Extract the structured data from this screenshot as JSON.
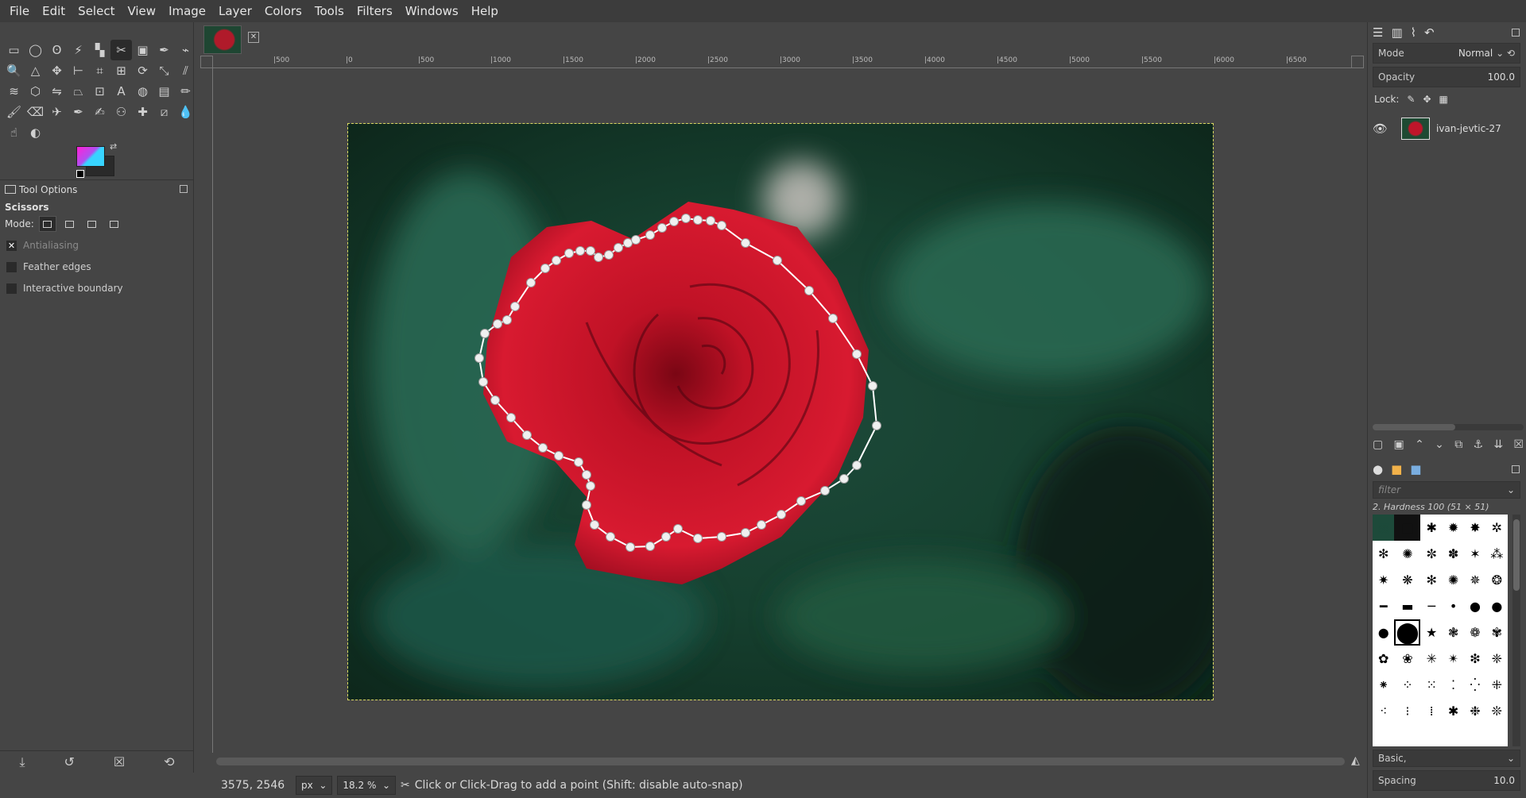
{
  "menubar": {
    "items": [
      "File",
      "Edit",
      "Select",
      "View",
      "Image",
      "Layer",
      "Colors",
      "Tools",
      "Filters",
      "Windows",
      "Help"
    ]
  },
  "toolbox": {
    "tools": [
      "rect-select-tool",
      "ellipse-select-tool",
      "free-select-tool",
      "fuzzy-select-tool",
      "select-by-color-tool",
      "scissors-select-tool",
      "foreground-select-tool",
      "paths-tool",
      "color-picker-tool",
      "zoom-tool",
      "measure-tool",
      "move-tool",
      "align-tool",
      "crop-tool",
      "unified-transform-tool",
      "rotate-tool",
      "scale-tool",
      "shear-tool",
      "warp-transform-tool",
      "cage-transform-tool",
      "flip-tool",
      "perspective-tool",
      "handle-transform-tool",
      "text-tool",
      "bucket-fill-tool",
      "gradient-tool",
      "pencil-tool",
      "paintbrush-tool",
      "eraser-tool",
      "airbrush-tool",
      "ink-tool",
      "mypaint-brush-tool",
      "clone-tool",
      "heal-tool",
      "perspective-clone-tool",
      "blur-sharpen-tool",
      "smudge-tool",
      "dodge-burn-tool"
    ],
    "active_tool": "scissors-select-tool",
    "colors": {
      "foreground": "#3fcfff",
      "background": "#2a2a2a"
    }
  },
  "tool_options": {
    "header": "Tool Options",
    "tool_name": "Scissors",
    "mode_label": "Mode:",
    "options": [
      {
        "label": "Antialiasing",
        "checked": true,
        "dim": true
      },
      {
        "label": "Feather edges",
        "checked": false,
        "dim": false
      },
      {
        "label": "Interactive boundary",
        "checked": false,
        "dim": false
      }
    ]
  },
  "ruler": {
    "top_labels": [
      "|500",
      "|0",
      "|500",
      "|1000",
      "|1500",
      "|2000",
      "|2500",
      "|3000",
      "|3500",
      "|4000",
      "|4500",
      "|5000",
      "|5500",
      "|6000",
      "|6500"
    ]
  },
  "statusbar": {
    "coords": "3575, 2546",
    "unit": "px",
    "zoom": "18.2 %",
    "message": "Click or Click-Drag to add a point (Shift: disable auto-snap)"
  },
  "layers": {
    "mode_label": "Mode",
    "mode_value": "Normal",
    "opacity_label": "Opacity",
    "opacity_value": "100.0",
    "lock_label": "Lock:",
    "layer_name": "ivan-jevtic-27"
  },
  "brushes": {
    "filter_placeholder": "filter",
    "selected_brush": "2. Hardness 100 (51 × 51)",
    "preset": "Basic,",
    "spacing_label": "Spacing",
    "spacing_value": "10.0"
  }
}
